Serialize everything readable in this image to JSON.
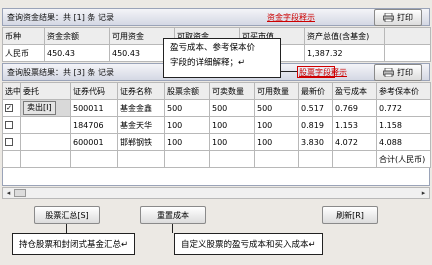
{
  "funds": {
    "title": "查询资金结果：共 [1] 条 记录",
    "link": "资金字段释示",
    "print_label": "打印",
    "headers": [
      "币种",
      "资金余额",
      "可用资金",
      "可取资金",
      "可买市值",
      "资产总值(含基金)"
    ],
    "rows": [
      [
        "人民币",
        "450.43",
        "450.43",
        "",
        "",
        "1,387.32"
      ]
    ]
  },
  "stocks": {
    "title": "查询股票结果：共 [3] 条 记录",
    "link": "股票字段释示",
    "print_label": "打印",
    "headers": [
      "选中",
      "委托",
      "证券代码",
      "证券名称",
      "股票余额",
      "可卖数量",
      "可用数量",
      "最新价",
      "盈亏成本",
      "参考保本价"
    ],
    "rows": [
      {
        "checked": "✓",
        "action": "卖出[I]",
        "code": "500011",
        "name": "基金金鑫",
        "balance": "500",
        "sellable": "500",
        "available": "500",
        "price": "0.517",
        "cost": "0.769",
        "breakeven": "0.772"
      },
      {
        "checked": "",
        "action": "",
        "code": "184706",
        "name": "基金天华",
        "balance": "100",
        "sellable": "100",
        "available": "100",
        "price": "0.819",
        "cost": "1.153",
        "breakeven": "1.158"
      },
      {
        "checked": "",
        "action": "",
        "code": "600001",
        "name": "邯郸钢铁",
        "balance": "100",
        "sellable": "100",
        "available": "100",
        "price": "3.830",
        "cost": "4.072",
        "breakeven": "4.088"
      }
    ],
    "total_label": "合计(人民币)"
  },
  "buttons": {
    "summary": "股票汇总[S]",
    "reset_cost": "重置成本",
    "refresh": "刷新[R]"
  },
  "callouts": {
    "top_line1": "盈亏成本、参考保本价",
    "top_line2": "字段的详细解释；↵",
    "bottom_left": "持仓股票和封闭式基金汇总↵",
    "bottom_right": "自定义股票的盈亏成本和买入成本↵"
  },
  "icons": {
    "print": "printer-icon",
    "left": "arrow-left-icon",
    "right": "arrow-right-icon"
  }
}
